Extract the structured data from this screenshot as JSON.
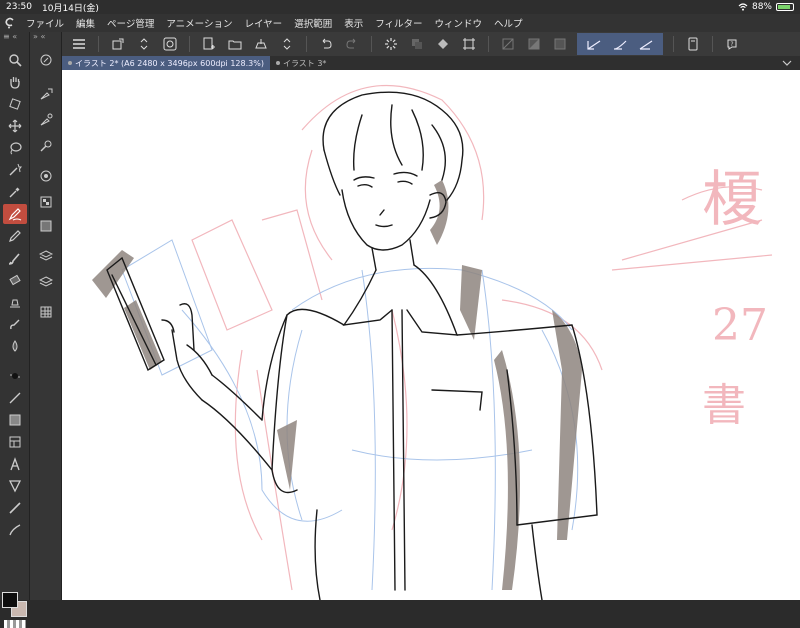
{
  "status_bar": {
    "time": "23:50",
    "date": "10月14日(金)",
    "battery_percent": "88%",
    "battery_level": 0.88
  },
  "menu": {
    "items": [
      "ファイル",
      "編集",
      "ページ管理",
      "アニメーション",
      "レイヤー",
      "選択範囲",
      "表示",
      "フィルター",
      "ウィンドウ",
      "ヘルプ"
    ]
  },
  "toolbar": {
    "icons": [
      "menu-icon",
      "transform-icon",
      "up-down-icon",
      "spiral-icon",
      "new-canvas-icon",
      "open-folder-icon",
      "save-cloud-icon",
      "up-down-icon",
      "undo-icon",
      "redo-icon",
      "loading-icon",
      "layer-copy-icon",
      "fill-icon",
      "crop-icon",
      "selection-clear-icon",
      "selection-invert-icon",
      "selection-show-icon",
      "stabilizer-1-icon",
      "stabilizer-2-icon",
      "stabilizer-3-icon",
      "device-icon",
      "help-icon"
    ]
  },
  "tabs": [
    {
      "label": "イラスト 2* (A6 2480 x 3496px 600dpi 128.3%)",
      "active": true
    },
    {
      "label": "イラスト 3*",
      "active": false
    }
  ],
  "tools": {
    "left_collapse": "≡ «",
    "sub_collapse": "» «",
    "items": [
      "zoom-icon",
      "hand-icon",
      "rotate-icon",
      "move-icon",
      "lasso-icon",
      "magic-wand-icon",
      "eyedropper-icon",
      "pen-icon",
      "pencil-icon",
      "brush-icon",
      "eraser-icon",
      "decoration-icon",
      "blend-icon",
      "fill-bucket-icon",
      "airbrush-icon",
      "line-icon",
      "gradient-icon",
      "frame-icon",
      "text-icon",
      "balloon-icon",
      "ruler-icon",
      "blend-drop-icon"
    ],
    "active_index": 7,
    "sub_items": [
      "nav-icon",
      "tool-prop-icon",
      "brush-size-icon",
      "color-icon",
      "material-icon",
      "layer-prop-icon",
      "timeline-icon",
      "layer-icon",
      "layer-search-icon",
      "grid-icon"
    ]
  },
  "colors": {
    "main": "#0d0d0d",
    "sub": "#c9b8b0",
    "accent_active": "#4b5d80",
    "tool_active": "#c24d3f"
  },
  "canvas": {
    "sketch_text_lines": [
      "榎",
      "27",
      "書"
    ]
  }
}
